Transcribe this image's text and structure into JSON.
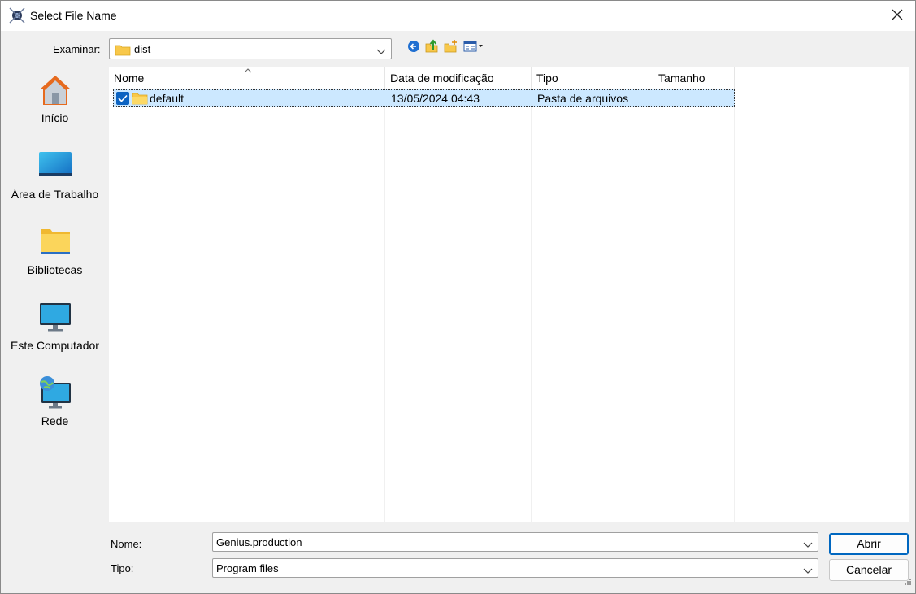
{
  "window": {
    "title": "Select File Name"
  },
  "toolbar": {
    "look_in_label": "Examinar:",
    "look_in_value": "dist",
    "icons": [
      "back-icon",
      "up-folder-icon",
      "new-folder-icon",
      "view-menu-icon"
    ]
  },
  "sidebar": {
    "items": [
      {
        "label": "Início",
        "icon": "home-icon"
      },
      {
        "label": "Área de Trabalho",
        "icon": "desktop-icon"
      },
      {
        "label": "Bibliotecas",
        "icon": "libraries-icon"
      },
      {
        "label": "Este Computador",
        "icon": "computer-icon"
      },
      {
        "label": "Rede",
        "icon": "network-icon"
      }
    ]
  },
  "filelist": {
    "columns": [
      "Nome",
      "Data de modificação",
      "Tipo",
      "Tamanho"
    ],
    "rows": [
      {
        "name": "default",
        "modified": "13/05/2024 04:43",
        "type": "Pasta de arquivos",
        "size": "",
        "selected": true
      }
    ]
  },
  "form": {
    "name_label": "Nome:",
    "name_value": "Genius.production",
    "type_label": "Tipo:",
    "type_value": "Program files",
    "open_label": "Abrir",
    "cancel_label": "Cancelar"
  },
  "colors": {
    "selection": "#cce8ff",
    "accent": "#0067c0",
    "folder": "#f8c84a"
  }
}
